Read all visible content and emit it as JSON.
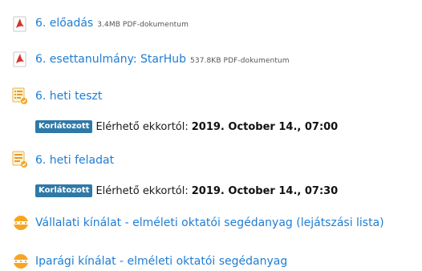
{
  "items": [
    {
      "title": "6. előadás",
      "meta": "3.4MB PDF-dokumentum",
      "icon": "pdf-icon"
    },
    {
      "title": "6. esettanulmány: StarHub",
      "meta": "537.8KB PDF-dokumentum",
      "icon": "pdf-icon"
    },
    {
      "title": "6. heti teszt",
      "icon": "quiz-icon",
      "restriction": {
        "badge": "Korlátozott",
        "label": "Elérhető ekkortól:",
        "value": "2019. October 14., 07:00"
      }
    },
    {
      "title": "6. heti feladat",
      "icon": "assignment-icon",
      "restriction": {
        "badge": "Korlátozott",
        "label": "Elérhető ekkortól:",
        "value": "2019. October 14., 07:30"
      }
    },
    {
      "title": "Vállalati kínálat - elméleti oktatói segédanyag (lejátszási lista)",
      "icon": "playlist-icon"
    },
    {
      "title": "Iparági kínálat - elméleti oktatói segédanyag",
      "icon": "playlist-icon"
    }
  ],
  "colors": {
    "link": "#1f7dd3",
    "badge": "#2f79a7",
    "pdf": "#d8312b",
    "orange": "#f5a623"
  }
}
